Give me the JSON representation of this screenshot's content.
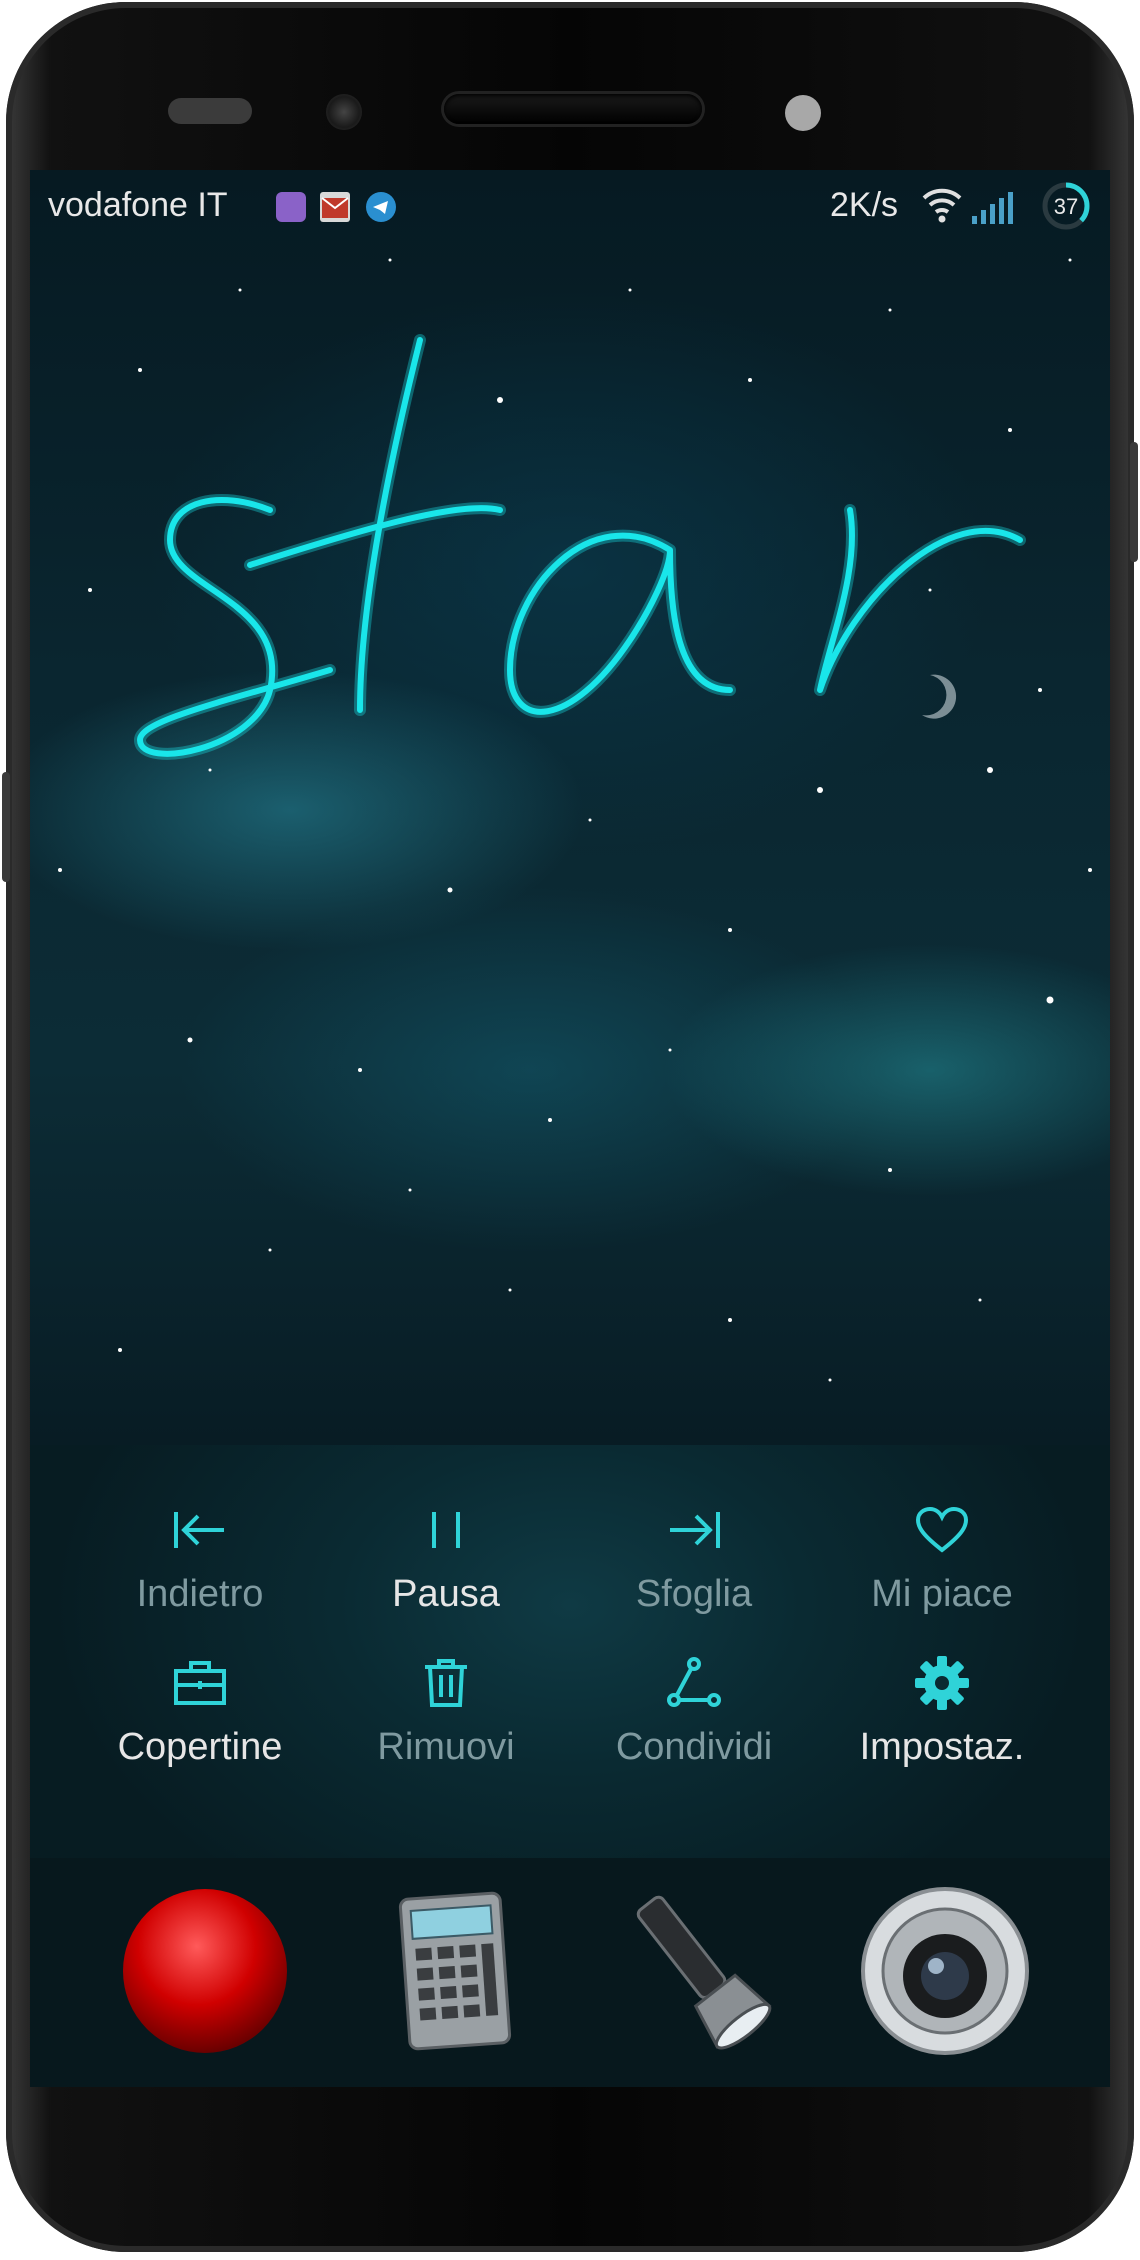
{
  "status_bar": {
    "carrier": "vodafone IT",
    "net_speed": "2K/s",
    "battery": "37",
    "notification_icons": [
      "gallery-icon",
      "mail-icon",
      "telegram-icon"
    ]
  },
  "wallpaper": {
    "neon_text": "star",
    "neon_color": "#19e6ea"
  },
  "controls": [
    {
      "label": "Indietro",
      "icon": "skip-back-icon",
      "active": false
    },
    {
      "label": "Pausa",
      "icon": "pause-icon",
      "active": true
    },
    {
      "label": "Sfoglia",
      "icon": "skip-forward-icon",
      "active": false
    },
    {
      "label": "Mi piace",
      "icon": "heart-icon",
      "active": false
    },
    {
      "label": "Copertine",
      "icon": "briefcase-icon",
      "active": true
    },
    {
      "label": "Rimuovi",
      "icon": "trash-icon",
      "active": false
    },
    {
      "label": "Condividi",
      "icon": "share-icon",
      "active": false
    },
    {
      "label": "Impostaz.",
      "icon": "gear-icon",
      "active": true
    }
  ],
  "dock": [
    "record-button-app",
    "calculator-app",
    "flashlight-app",
    "camera-app"
  ],
  "colors": {
    "accent": "#2fd3d8",
    "active_label": "#e6e6e6",
    "dim_label": "#7f9aa0"
  }
}
